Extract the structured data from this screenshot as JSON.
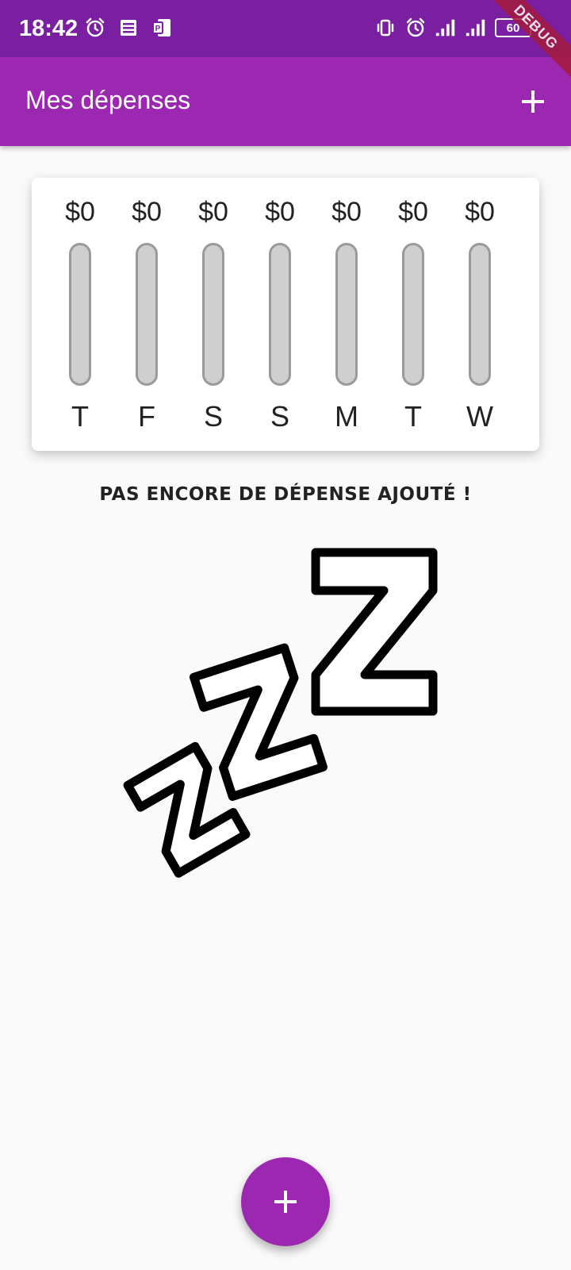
{
  "status_bar": {
    "time": "18:42",
    "left_icons": [
      "alarm-icon",
      "news-icon",
      "publisher-icon"
    ],
    "right_icons": [
      "vibrate-icon",
      "alarm-icon",
      "signal-icon",
      "signal-icon"
    ],
    "battery": "60"
  },
  "debug_banner": "DEBUG",
  "app_bar": {
    "title": "Mes dépenses",
    "action_icon": "add-icon"
  },
  "chart_data": {
    "type": "bar",
    "categories": [
      "T",
      "F",
      "S",
      "S",
      "M",
      "T",
      "W"
    ],
    "values": [
      0,
      0,
      0,
      0,
      0,
      0,
      0
    ],
    "labels": [
      "$0",
      "$0",
      "$0",
      "$0",
      "$0",
      "$0",
      "$0"
    ],
    "fill_fraction": [
      0,
      0,
      0,
      0,
      0,
      0,
      0
    ],
    "colors": {
      "fill": "#9c27b0",
      "track": "#cfcfcf"
    }
  },
  "empty_state": {
    "message": "PAS ENCORE DE DÉPENSE AJOUTÉ !",
    "image_icon": "sleeping-zzz-icon"
  },
  "fab": {
    "icon": "add-icon"
  },
  "colors": {
    "primary": "#9c27b0",
    "primary_dark": "#7b1fa2"
  }
}
